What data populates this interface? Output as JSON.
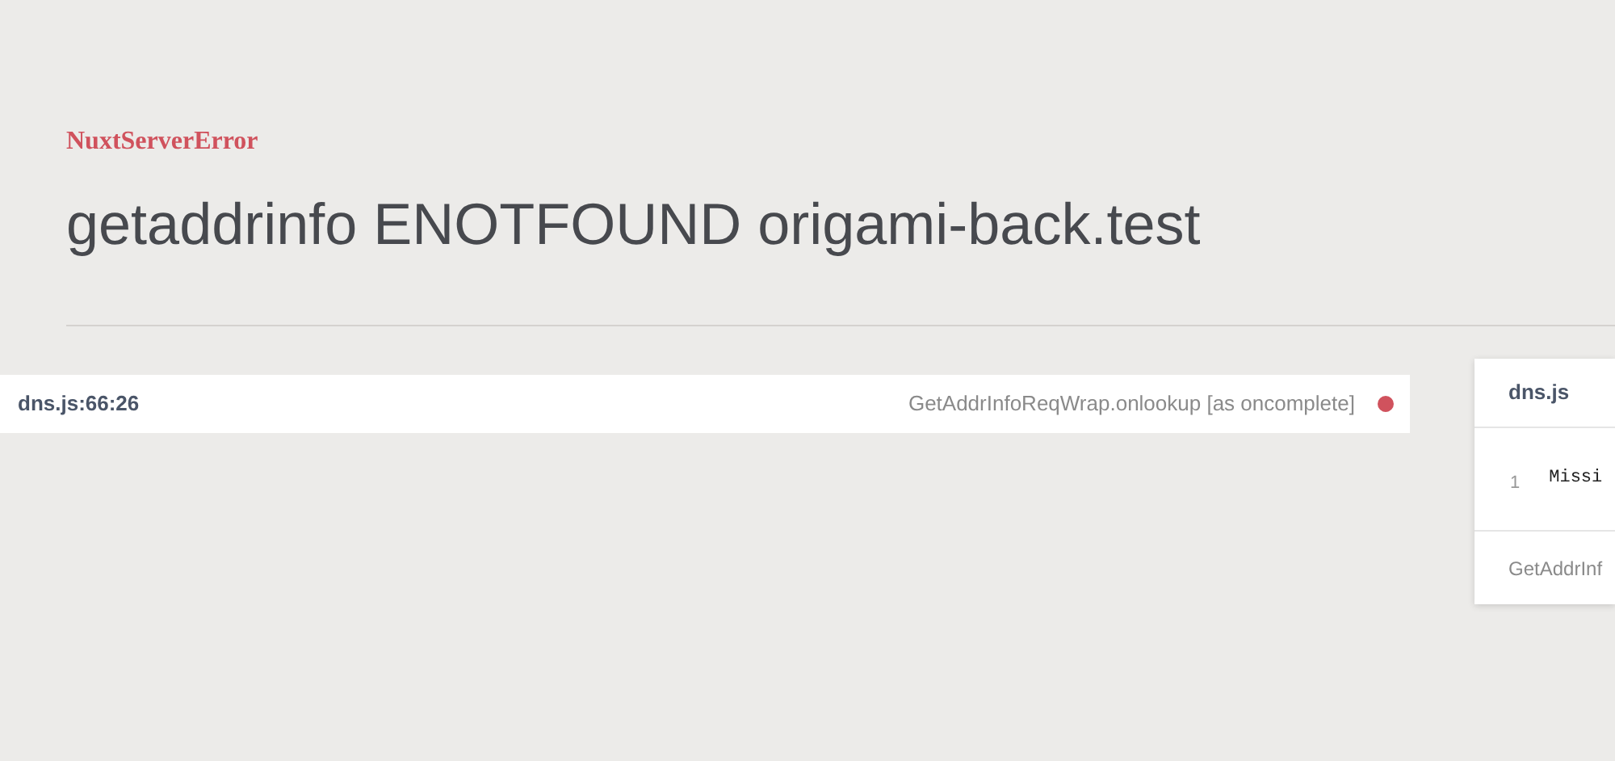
{
  "error": {
    "type": "NuxtServerError",
    "message": "getaddrinfo ENOTFOUND origami-back.test"
  },
  "frames": [
    {
      "location": "dns.js:66:26",
      "function": "GetAddrInfoReqWrap.onlookup [as oncomplete]",
      "selected": true
    }
  ],
  "source_panel": {
    "file": "dns.js",
    "line_number": "1",
    "code": "Missi",
    "footer": "GetAddrInf"
  }
}
